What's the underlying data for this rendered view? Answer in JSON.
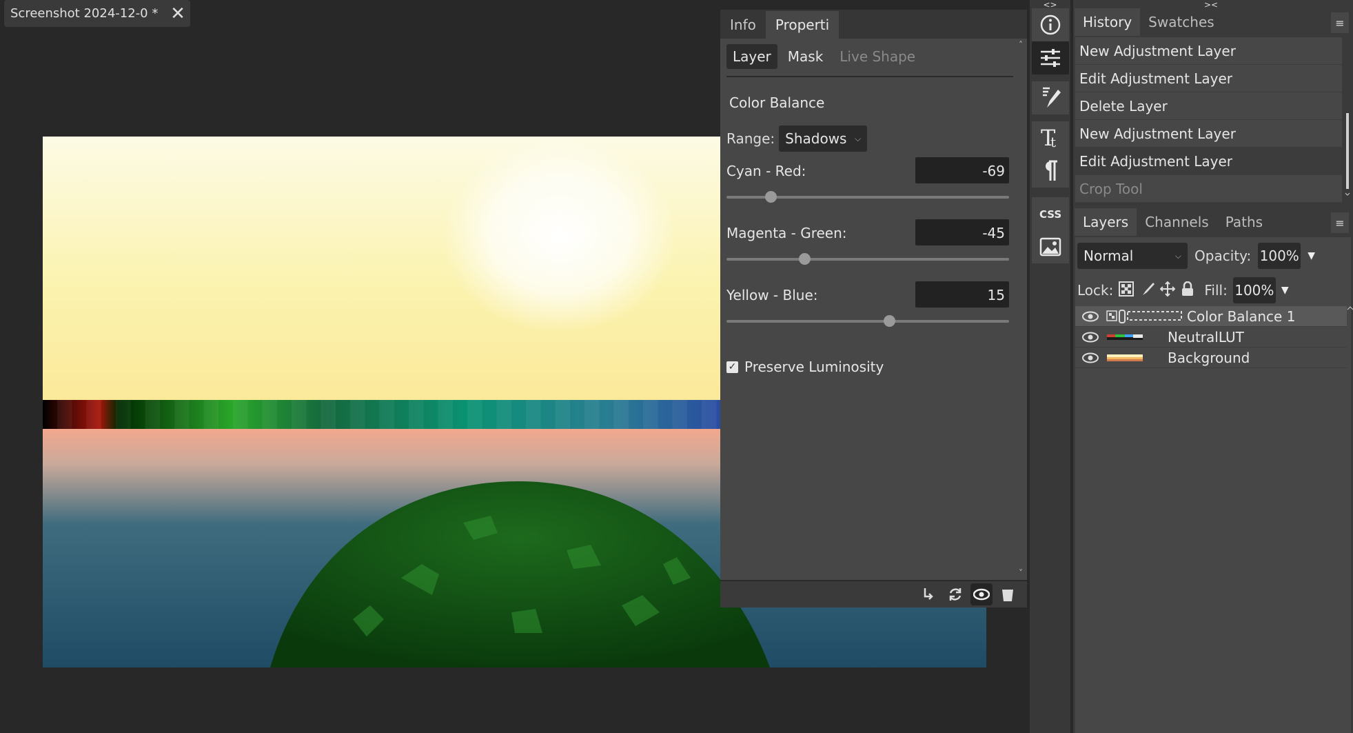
{
  "document_tab": {
    "title": "Screenshot 2024-12-0",
    "modified_marker": "*",
    "close": "✕"
  },
  "properties": {
    "tabs": [
      {
        "label": "Info"
      },
      {
        "label": "Properti"
      }
    ],
    "subtabs": [
      {
        "label": "Layer"
      },
      {
        "label": "Mask"
      },
      {
        "label": "Live Shape"
      }
    ],
    "heading": "Color Balance",
    "range_label": "Range:",
    "range_value": "Shadows",
    "sliders": [
      {
        "label": "Cyan - Red:",
        "value": "-69",
        "min": -100,
        "max": 100
      },
      {
        "label": "Magenta - Green:",
        "value": "-45",
        "min": -100,
        "max": 100
      },
      {
        "label": "Yellow - Blue:",
        "value": "15",
        "min": -100,
        "max": 100
      }
    ],
    "preserve_luminosity": {
      "label": "Preserve Luminosity",
      "checked": true
    }
  },
  "toolbar": {
    "top_arrows": "<>",
    "tools": [
      "info-icon",
      "adjustments-icon",
      "brush-settings-icon",
      "character-icon",
      "paragraph-icon",
      "css-icon",
      "image-icon"
    ]
  },
  "history_panel": {
    "top_arrows": "><",
    "tabs": [
      {
        "label": "History"
      },
      {
        "label": "Swatches"
      }
    ],
    "menu": "≡",
    "items": [
      {
        "label": "New Adjustment Layer"
      },
      {
        "label": "Edit Adjustment Layer"
      },
      {
        "label": "Delete Layer"
      },
      {
        "label": "New Adjustment Layer"
      },
      {
        "label": "Edit Adjustment Layer"
      },
      {
        "label": "Crop Tool"
      }
    ]
  },
  "layers_panel": {
    "tabs": [
      {
        "label": "Layers"
      },
      {
        "label": "Channels"
      },
      {
        "label": "Paths"
      }
    ],
    "menu": "≡",
    "blend_mode": "Normal",
    "opacity_label": "Opacity:",
    "opacity": "100%",
    "lock_label": "Lock:",
    "fill_label": "Fill:",
    "fill": "100%",
    "layers": [
      {
        "name": "Color Balance 1",
        "selected": true
      },
      {
        "name": "NeutralLUT",
        "selected": false
      },
      {
        "name": "Background",
        "selected": false
      }
    ]
  },
  "colors": {
    "accent_selected": "#595959",
    "panel": "#474747",
    "dark": "#282828"
  }
}
